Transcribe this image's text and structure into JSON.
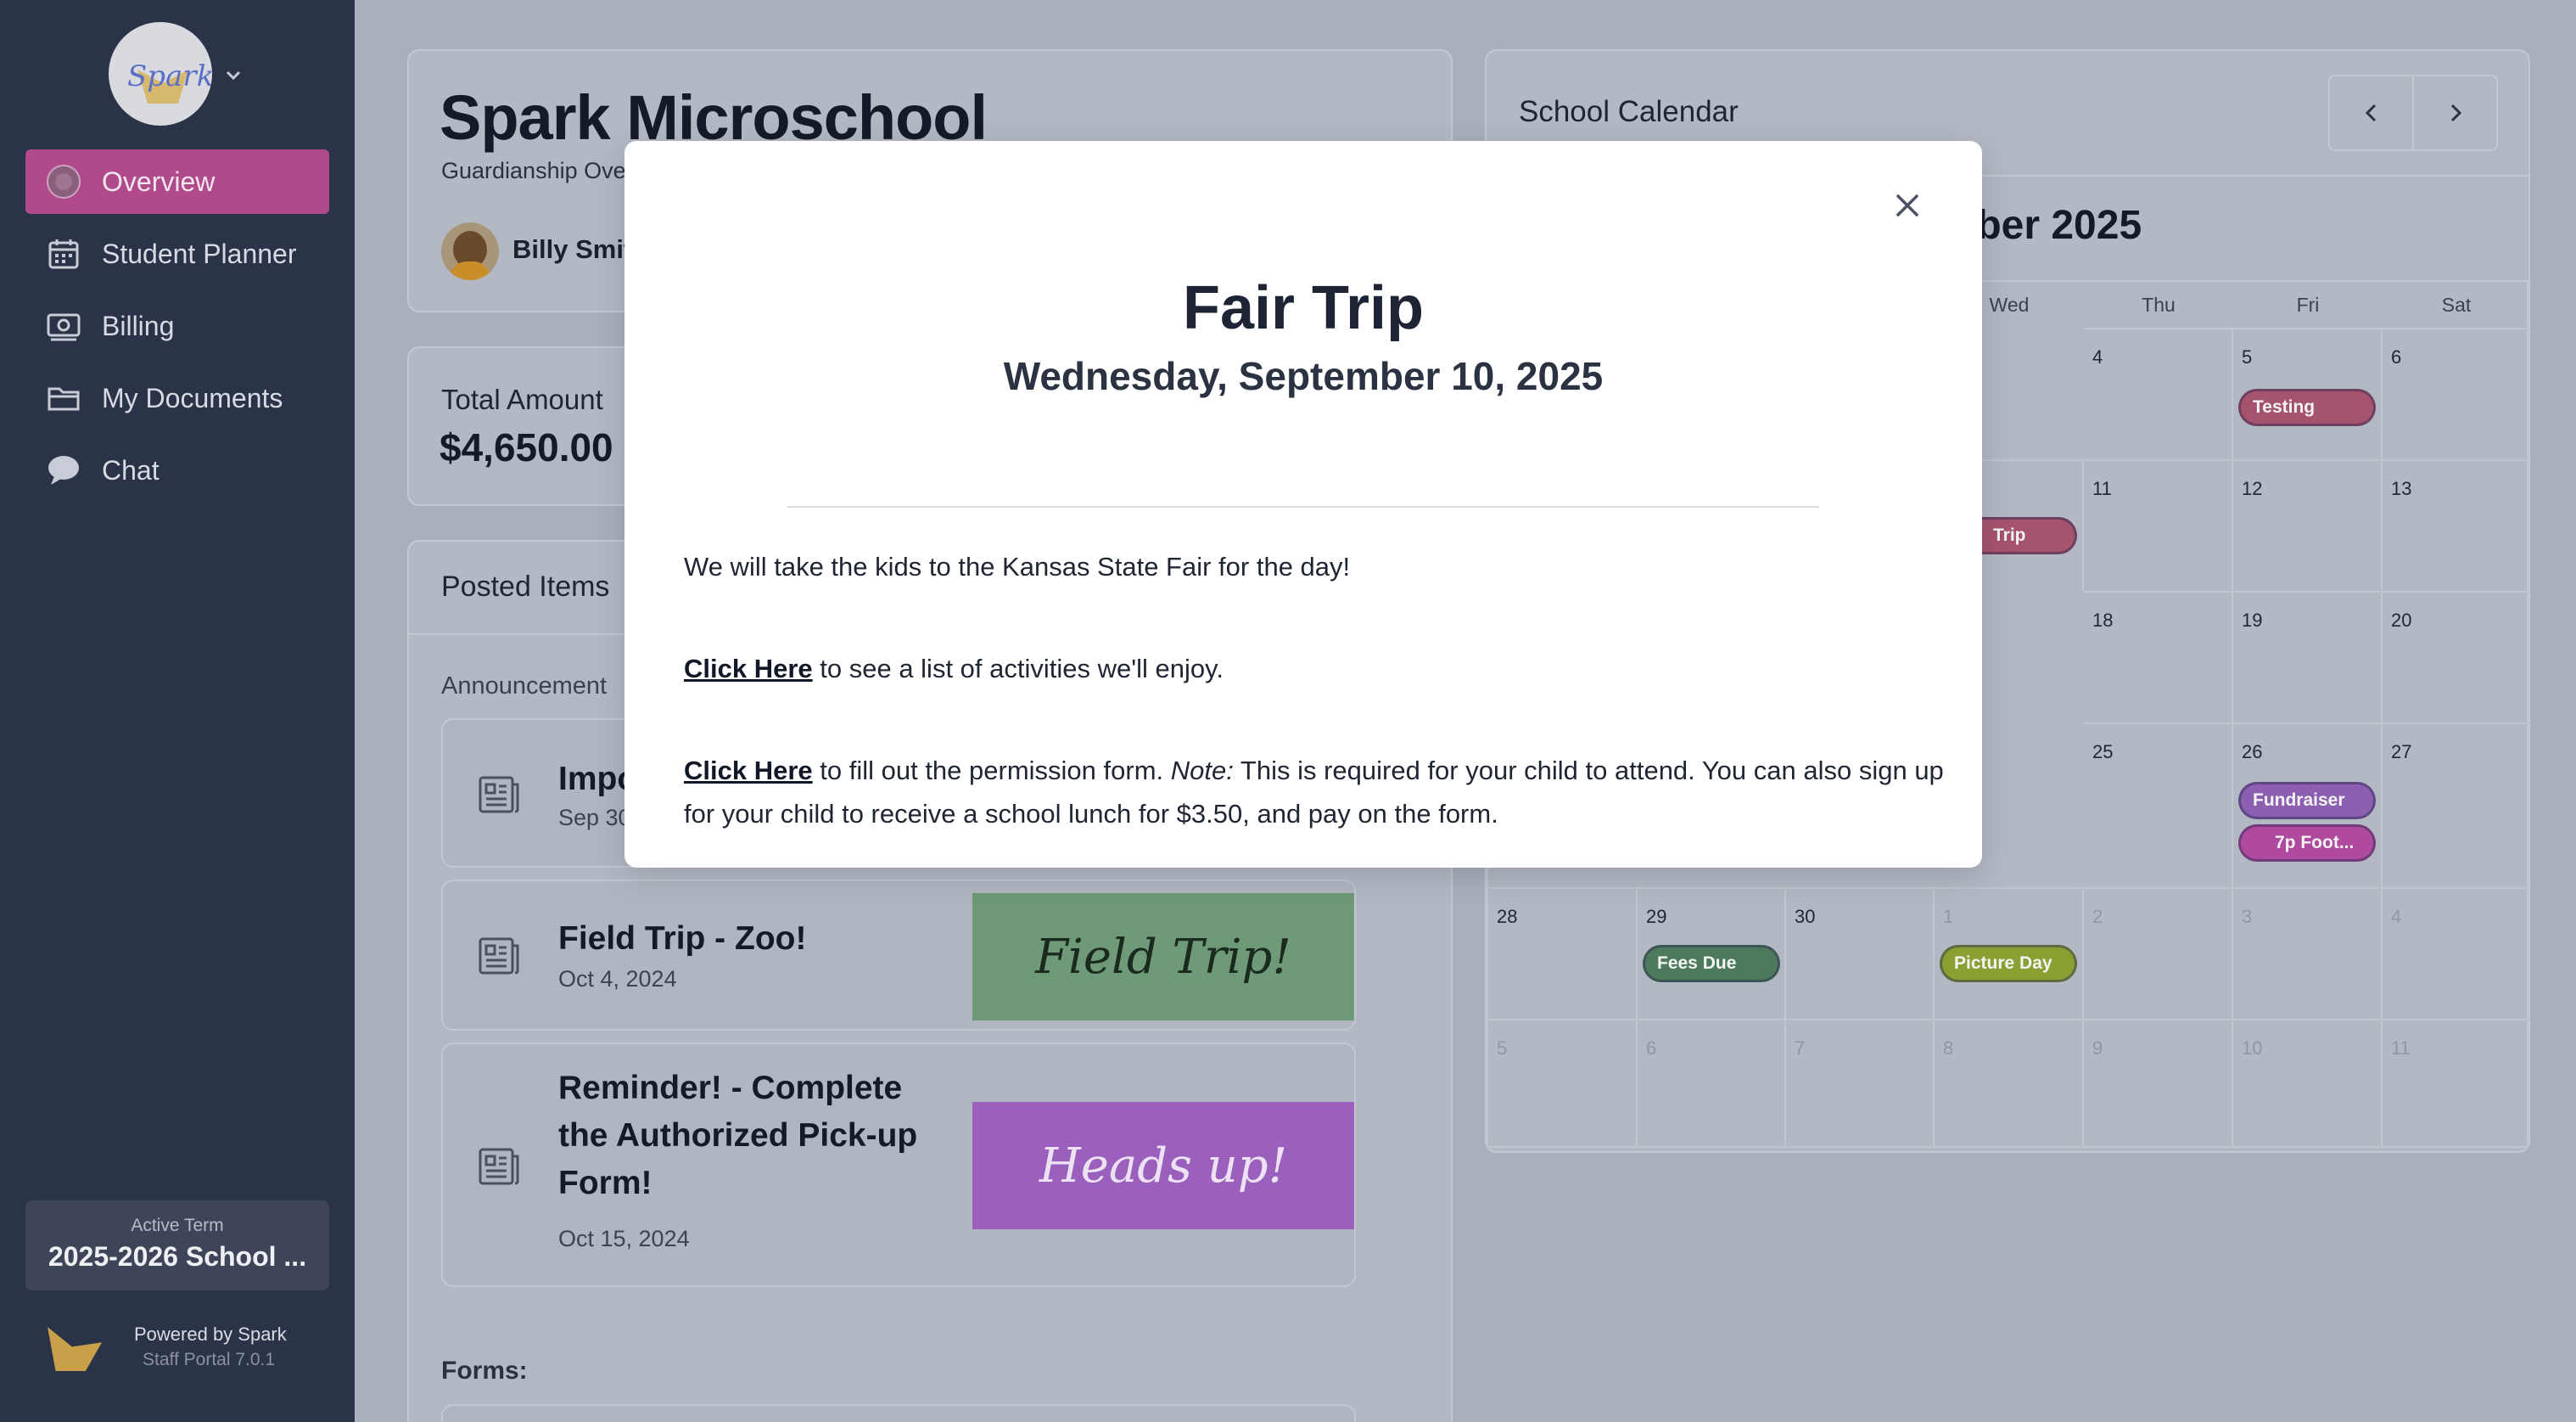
{
  "sidebar": {
    "logo_text": "Spark",
    "nav": [
      {
        "label": "Overview",
        "icon": "overview-icon",
        "active": true
      },
      {
        "label": "Student Planner",
        "icon": "calendar-icon",
        "active": false
      },
      {
        "label": "Billing",
        "icon": "billing-icon",
        "active": false
      },
      {
        "label": "My Documents",
        "icon": "folder-icon",
        "active": false
      },
      {
        "label": "Chat",
        "icon": "chat-icon",
        "active": false
      }
    ],
    "term_label": "Active Term",
    "term_value": "2025-2026 School ...",
    "powered_by": "Powered by Spark",
    "version": "Staff Portal 7.0.1"
  },
  "main": {
    "school_name": "Spark Microschool",
    "subtitle": "Guardianship Ove",
    "child_name": "Billy Smit",
    "total_label": "Total Amount",
    "total_value": "$4,650.00",
    "posted_title": "Posted Items",
    "announcements_label": "Announcement",
    "posts": [
      {
        "title": "Impo",
        "date": "Sep 30"
      },
      {
        "title": "Field Trip - Zoo!",
        "date": "Oct 4, 2024",
        "image_text": "Field Trip!"
      },
      {
        "title": "Reminder! - Complete the Authorized Pick-up Form!",
        "date": "Oct 15, 2024",
        "image_text": "Heads up!"
      }
    ],
    "forms_label": "Forms:"
  },
  "calendar": {
    "title": "School Calendar",
    "month": "nber 2025",
    "weekdays": [
      "Wed",
      "Thu",
      "Fri",
      "Sat"
    ],
    "rows": [
      [
        "",
        "4",
        "5",
        "6"
      ],
      [
        "",
        "11",
        "12",
        "13"
      ],
      [
        "",
        "18",
        "19",
        "20"
      ],
      [
        "",
        "25",
        "26",
        "27"
      ]
    ],
    "row5": [
      "28",
      "29",
      "30",
      "1",
      "2",
      "3",
      "4"
    ],
    "row6": [
      "5",
      "6",
      "7",
      "8",
      "9",
      "10",
      "11"
    ],
    "events": {
      "testing": "Testing",
      "trip": "Trip",
      "fundraiser": "Fundraiser",
      "football": "7p Foot...",
      "fees_due": "Fees Due",
      "picture_day": "Picture Day"
    }
  },
  "modal": {
    "title": "Fair Trip",
    "date": "Wednesday, September 10, 2025",
    "para1": "We will take the kids to the Kansas State Fair for the day!",
    "link1": "Click Here",
    "para2_rest": " to see a list of activities we'll enjoy.",
    "link2": "Click Here",
    "para3_a": " to fill out the permission form. ",
    "para3_note": "Note:",
    "para3_b": " This is required for your child to attend. You can also sign up for your child to receive a school lunch for $3.50, and pay on the form."
  },
  "colors": {
    "sidebar_bg": "#2b3348",
    "active_nav": "#b04a8a",
    "overlay_bg": "#a9b0bc",
    "testing": "#a6536e",
    "trip": "#a6536e",
    "fundraiser": "#8c5fb0",
    "football": "#b04a9e",
    "fees_due": "#4d7a5c",
    "picture_day": "#8aa032"
  }
}
